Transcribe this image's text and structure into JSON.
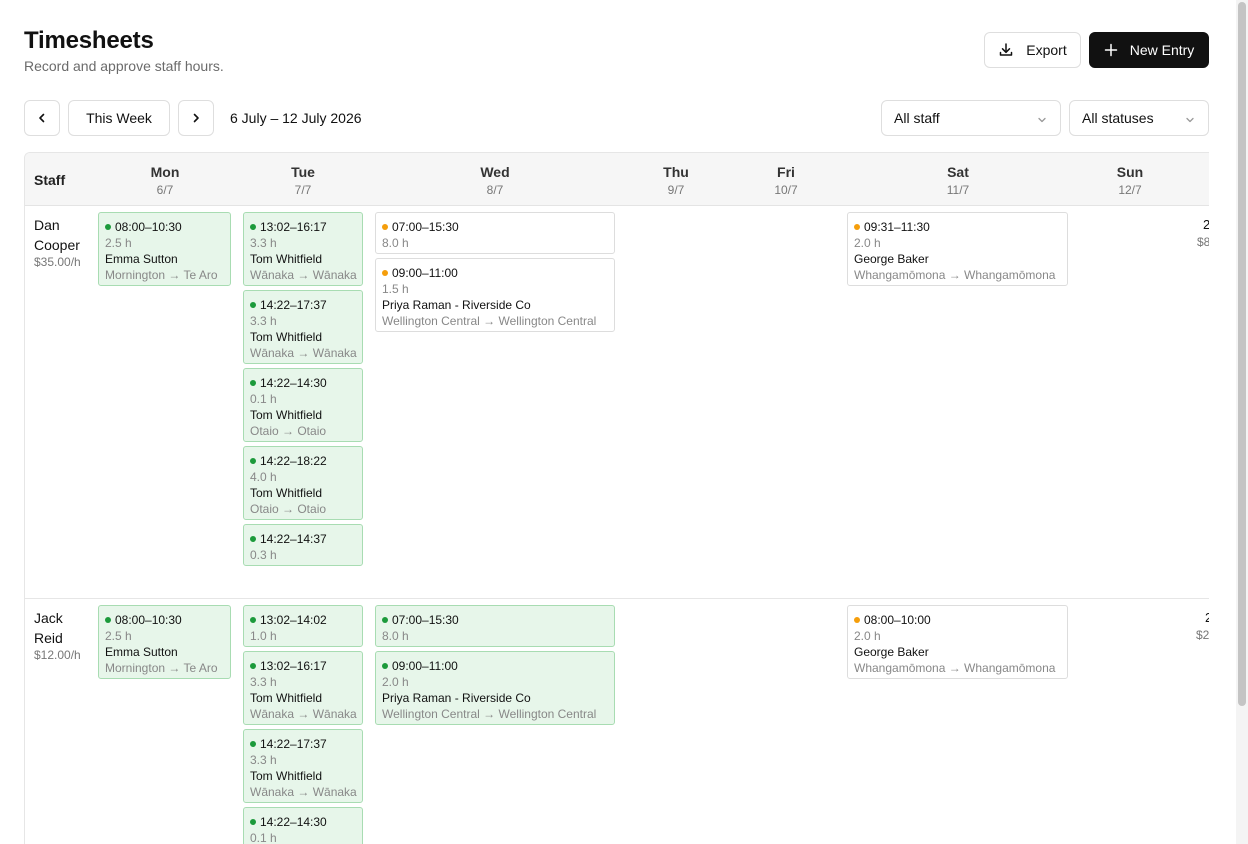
{
  "header": {
    "title": "Timesheets",
    "subtitle": "Record and approve staff hours.",
    "export_label": "Export",
    "new_entry_label": "New Entry"
  },
  "toolbar": {
    "this_week_label": "This Week",
    "date_range": "6 July – 12 July 2026",
    "staff_filter": "All staff",
    "status_filter": "All statuses"
  },
  "grid": {
    "staff_header": "Staff",
    "days": [
      {
        "name": "Mon",
        "date": "6/7"
      },
      {
        "name": "Tue",
        "date": "7/7"
      },
      {
        "name": "Wed",
        "date": "8/7"
      },
      {
        "name": "Thu",
        "date": "9/7"
      },
      {
        "name": "Fri",
        "date": "10/7"
      },
      {
        "name": "Sat",
        "date": "11/7"
      },
      {
        "name": "Sun",
        "date": "12/7"
      }
    ]
  },
  "rows": [
    {
      "name": "Dan Cooper",
      "rate": "$35.00/h",
      "total_clipped": "2",
      "amount_clipped": "$8",
      "entries": {
        "mon": [
          {
            "status": "approved",
            "time": "08:00–10:30",
            "hours": "2.5 h",
            "client": "Emma Sutton",
            "route": "Mornington → Te Aro"
          }
        ],
        "tue": [
          {
            "status": "approved",
            "time": "13:02–16:17",
            "hours": "3.3 h",
            "client": "Tom Whitfield",
            "route": "Wānaka → Wānaka"
          },
          {
            "status": "approved",
            "time": "14:22–17:37",
            "hours": "3.3 h",
            "client": "Tom Whitfield",
            "route": "Wānaka → Wānaka"
          },
          {
            "status": "approved",
            "time": "14:22–14:30",
            "hours": "0.1 h",
            "client": "Tom Whitfield",
            "route": "Otaio → Otaio"
          },
          {
            "status": "approved",
            "time": "14:22–18:22",
            "hours": "4.0 h",
            "client": "Tom Whitfield",
            "route": "Otaio → Otaio"
          },
          {
            "status": "approved",
            "time": "14:22–14:37",
            "hours": "0.3 h"
          }
        ],
        "wed": [
          {
            "status": "pending",
            "time": "07:00–15:30",
            "hours": "8.0 h"
          },
          {
            "status": "pending",
            "time": "09:00–11:00",
            "hours": "1.5 h",
            "client": "Priya Raman - Riverside Co",
            "route": "Wellington Central → Wellington Central"
          }
        ],
        "sat": [
          {
            "status": "pending",
            "time": "09:31–11:30",
            "hours": "2.0 h",
            "client": "George Baker",
            "route": "Whangamōmona → Whangamōmona"
          }
        ]
      }
    },
    {
      "name": "Jack Reid",
      "rate": "$12.00/h",
      "total_clipped": "2",
      "amount_clipped": "$2",
      "entries": {
        "mon": [
          {
            "status": "approved",
            "time": "08:00–10:30",
            "hours": "2.5 h",
            "client": "Emma Sutton",
            "route": "Mornington → Te Aro"
          }
        ],
        "tue": [
          {
            "status": "approved",
            "time": "13:02–14:02",
            "hours": "1.0 h"
          },
          {
            "status": "approved",
            "time": "13:02–16:17",
            "hours": "3.3 h",
            "client": "Tom Whitfield",
            "route": "Wānaka → Wānaka"
          },
          {
            "status": "approved",
            "time": "14:22–17:37",
            "hours": "3.3 h",
            "client": "Tom Whitfield",
            "route": "Wānaka → Wānaka"
          },
          {
            "status": "approved",
            "time": "14:22–14:30",
            "hours": "0.1 h"
          }
        ],
        "wed": [
          {
            "status": "approved",
            "time": "07:00–15:30",
            "hours": "8.0 h"
          },
          {
            "status": "approved",
            "time": "09:00–11:00",
            "hours": "2.0 h",
            "client": "Priya Raman - Riverside Co",
            "route": "Wellington Central → Wellington Central"
          }
        ],
        "sat": [
          {
            "status": "pending",
            "time": "08:00–10:00",
            "hours": "2.0 h",
            "client": "George Baker",
            "route": "Whangamōmona → Whangamōmona"
          }
        ]
      }
    }
  ],
  "colors": {
    "approved_bg": "#e7f6ea",
    "approved_dot": "#1c9a3b",
    "pending_dot": "#f59e0b",
    "primary_button": "#111111"
  },
  "icons": {
    "export": "download-icon",
    "new_entry": "plus-icon",
    "prev": "chevron-left-icon",
    "next": "chevron-right-icon",
    "select": "chevron-down-icon"
  }
}
